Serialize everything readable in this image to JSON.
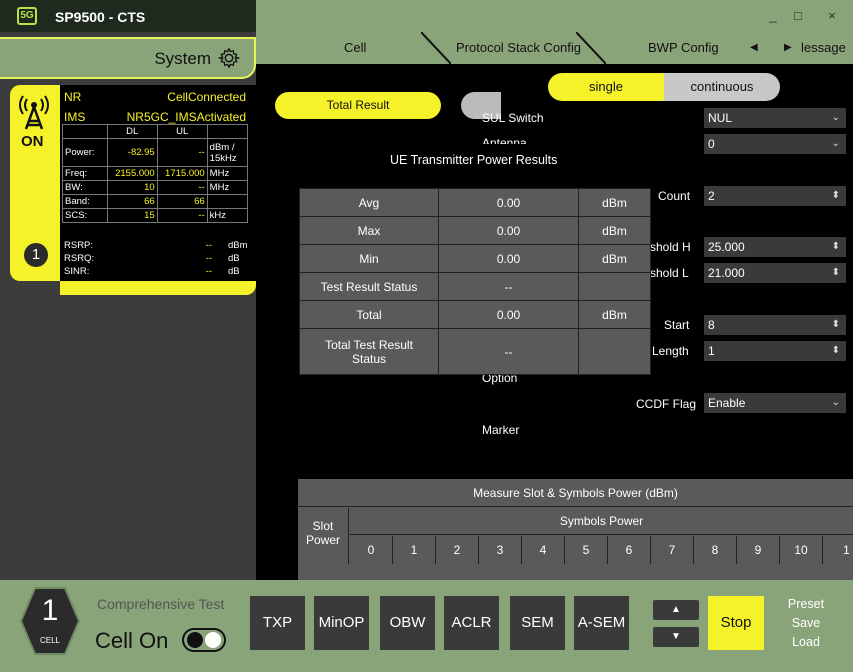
{
  "app": {
    "logo": "5G",
    "title": "SP9500 - CTS"
  },
  "window": {
    "minimize": "_",
    "maximize": "□",
    "close": "×"
  },
  "system": {
    "label": "System",
    "icon": "gear-icon"
  },
  "status": {
    "nr_label": "NR",
    "nr_value": "CellConnected",
    "ims_label": "IMS",
    "ims_value": "NR5GC_IMSActivated",
    "on_label": "ON",
    "cell_number": "1",
    "table": {
      "headers": [
        "",
        "DL",
        "UL",
        ""
      ],
      "rows": [
        [
          "Power:",
          "-82.95",
          "--",
          "dBm / 15kHz"
        ],
        [
          "Freq:",
          "2155.000",
          "1715.000",
          "MHz"
        ],
        [
          "BW:",
          "10",
          "--",
          "MHz"
        ],
        [
          "Band:",
          "66",
          "66",
          ""
        ],
        [
          "SCS:",
          "15",
          "--",
          "kHz"
        ]
      ]
    },
    "rsrp": {
      "label": "RSRP:",
      "value": "--",
      "unit": "dBm"
    },
    "rsrq": {
      "label": "RSRQ:",
      "value": "--",
      "unit": "dB"
    },
    "sinr": {
      "label": "SINR:",
      "value": "--",
      "unit": "dB"
    }
  },
  "tabs": {
    "cell": "Cell",
    "protocol": "Protocol Stack Config",
    "bwp": "BWP Config",
    "message": "lessage"
  },
  "mode": {
    "single": "single",
    "continuous": "continuous"
  },
  "total_result": "Total Result",
  "fields": {
    "sul_switch": {
      "label": "SUL Switch",
      "value": "NUL"
    },
    "antenna": {
      "label": "Antenna",
      "value": "0"
    },
    "count": {
      "label": "Count",
      "value": "2"
    },
    "threshold_h": {
      "label": "shold H",
      "value": "25.000"
    },
    "threshold_l": {
      "label": "shold L",
      "value": "21.000"
    },
    "start": {
      "label": "Start",
      "value": "8"
    },
    "length": {
      "label": "Length",
      "value": "1"
    },
    "option": {
      "label": "Option"
    },
    "ccdf_flag": {
      "label": "CCDF Flag",
      "value": "Enable"
    },
    "marker": {
      "label": "Marker"
    }
  },
  "ue_results": {
    "title": "UE Transmitter Power Results",
    "rows": [
      [
        "Avg",
        "0.00",
        "dBm"
      ],
      [
        "Max",
        "0.00",
        "dBm"
      ],
      [
        "Min",
        "0.00",
        "dBm"
      ],
      [
        "Test Result Status",
        "--",
        ""
      ],
      [
        "Total",
        "0.00",
        "dBm"
      ],
      [
        "Total Test Result Status",
        "--",
        ""
      ]
    ]
  },
  "measure": {
    "title": "Measure Slot & Symbols Power (dBm)",
    "slot_power": "Slot Power",
    "symbols_power": "Symbols Power",
    "columns": [
      "0",
      "1",
      "2",
      "3",
      "4",
      "5",
      "6",
      "7",
      "8",
      "9",
      "10",
      "1"
    ]
  },
  "bottom": {
    "cell_number": "1",
    "cell_label": "CELL",
    "comprehensive_test": "Comprehensive Test",
    "cell_on": "Cell On",
    "buttons": [
      "TXP",
      "MinOP",
      "OBW",
      "ACLR",
      "SEM",
      "A-SEM"
    ],
    "up": "▲",
    "down": "▼",
    "stop": "Stop",
    "preset": "Preset",
    "save": "Save",
    "load": "Load"
  },
  "colors": {
    "accent": "#f6f22a",
    "panel": "#8aa47a",
    "dark": "#3c3c3c"
  }
}
